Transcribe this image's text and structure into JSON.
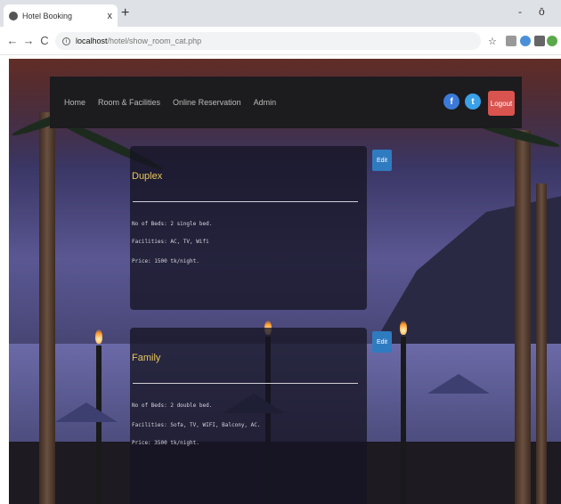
{
  "browser": {
    "tab_title": "Hotel Booking",
    "tab_close": "x",
    "new_tab": "+",
    "minimize": "-",
    "restore": "ō",
    "url_host": "localhost",
    "url_path": "/hotel/show_room_cat.php",
    "nav_back": "←",
    "nav_forward": "→",
    "nav_reload": "C",
    "star": "☆"
  },
  "navbar": {
    "links": [
      "Home",
      "Room & Facilities",
      "Online Reservation",
      "Admin"
    ],
    "facebook": "f",
    "twitter": "t",
    "logout_label": "Logout"
  },
  "rooms": [
    {
      "title": "Duplex",
      "beds": "No of Beds: 2 single bed.",
      "facilities": "Facilities: AC, TV, Wifi",
      "price": "Price: 1500 tk/night.",
      "edit_label": "Edit"
    },
    {
      "title": "Family",
      "beds": "No of Beds: 2 double bed.",
      "facilities": "Facilities: Sofa, TV, WIFI, Balcony, AC.",
      "price": "Price: 3500 tk/night.",
      "edit_label": "Edit"
    }
  ],
  "colors": {
    "navbar_bg": "#1c1b1e",
    "logout_bg": "#d9534f",
    "edit_bg": "#2f7bc0",
    "card_title": "#e8c85a"
  }
}
